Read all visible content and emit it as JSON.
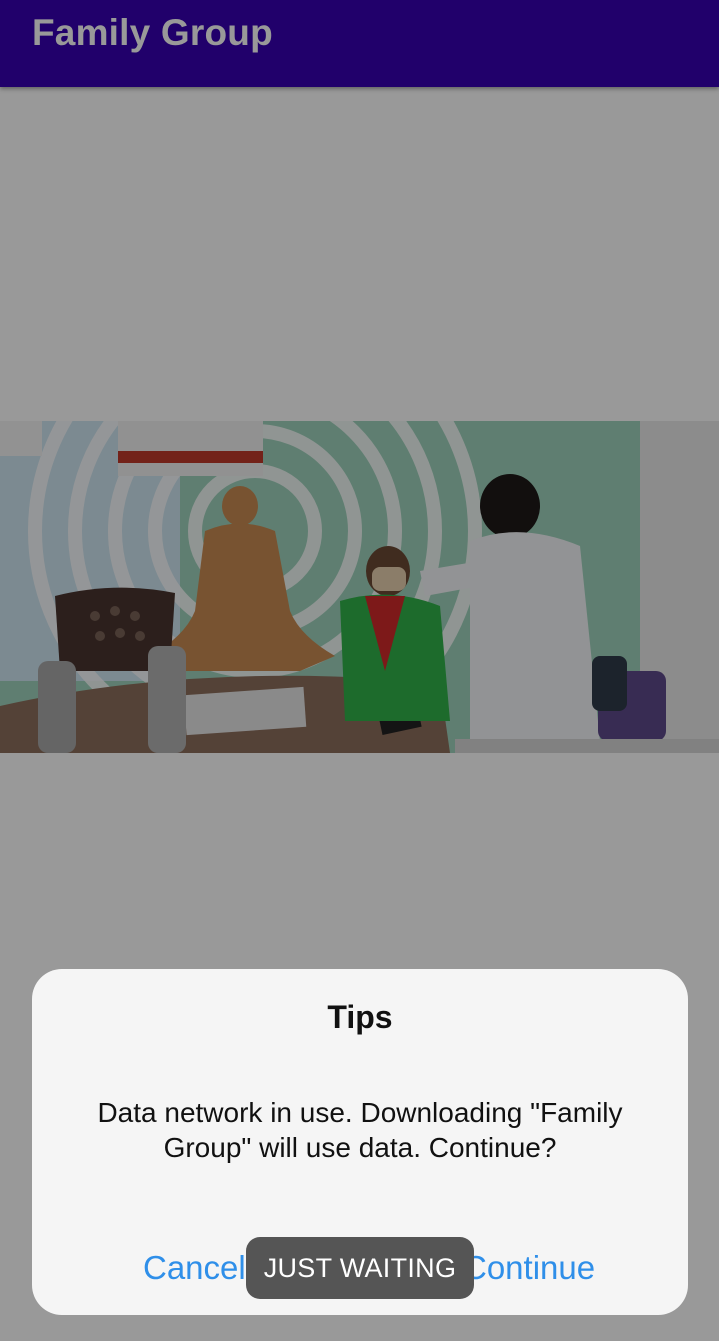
{
  "appbar": {
    "title": "Family Group",
    "color": "#3700b3"
  },
  "content": {
    "photo_description_icon": "vaccination-photo"
  },
  "dialog": {
    "title": "Tips",
    "message": "Data network in use. Downloading \"Family Group\" will use data. Continue?",
    "cancel_label": "Cancel",
    "continue_label": "Continue",
    "button_color": "#2f8fe9"
  },
  "toast": {
    "text": "JUST WAITING"
  }
}
